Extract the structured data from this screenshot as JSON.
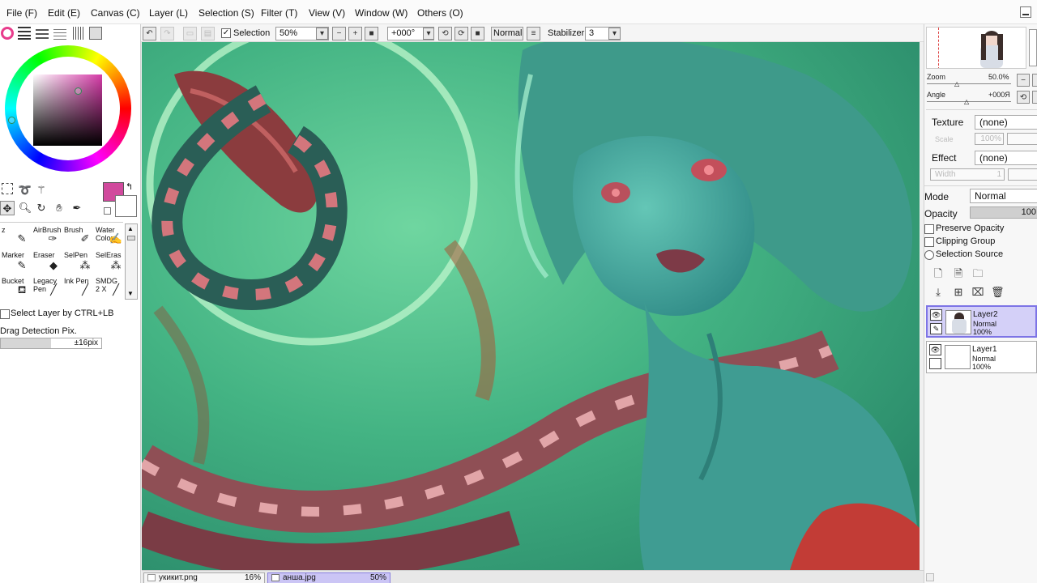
{
  "menu": [
    {
      "label": "File (F)"
    },
    {
      "label": "Edit (E)"
    },
    {
      "label": "Canvas (C)"
    },
    {
      "label": "Layer (L)"
    },
    {
      "label": "Selection (S)"
    },
    {
      "label": "Filter (T)"
    },
    {
      "label": "View (V)"
    },
    {
      "label": "Window (W)"
    },
    {
      "label": "Others (O)"
    }
  ],
  "toolbar": {
    "selection_label": "Selection",
    "selection_checked": "✓",
    "zoom_value": "50%",
    "angle_value": "+000°",
    "blend_mode": "Normal",
    "stabilizer_label": "Stabilizer",
    "stabilizer_value": "3"
  },
  "colors": {
    "primary": "#d14a9d",
    "secondary": "#ffffff",
    "layer_selected": "#d4d0f8"
  },
  "brushes": [
    {
      "label": "z",
      "icon": "pen-icon"
    },
    {
      "label": "AirBrush",
      "icon": "airbrush-icon"
    },
    {
      "label": "Brush",
      "icon": "brush-icon"
    },
    {
      "label": "Water Color",
      "icon": "watercolor-icon"
    },
    {
      "label": "Marker",
      "icon": "marker-icon"
    },
    {
      "label": "Eraser",
      "icon": "eraser-icon"
    },
    {
      "label": "SelPen",
      "icon": "selpen-icon"
    },
    {
      "label": "SelEras",
      "icon": "seleras-icon"
    },
    {
      "label": "Bucket",
      "icon": "bucket-icon"
    },
    {
      "label": "Legacy Pen",
      "icon": "legacy-pen-icon"
    },
    {
      "label": "Ink Pen",
      "icon": "ink-pen-icon"
    },
    {
      "label": "SMDG 2 X",
      "icon": "smdg-icon"
    }
  ],
  "left_options": {
    "select_layer_label": "Select Layer by CTRL+LB",
    "drag_detection_label": "Drag Detection Pix.",
    "drag_detection_value": "±16pix"
  },
  "navigator": {
    "zoom_label": "Zoom",
    "zoom_value": "50.0%",
    "angle_label": "Angle",
    "angle_value": "+000Я"
  },
  "properties": {
    "texture_label": "Texture",
    "texture_value": "(none)",
    "scale_label": "Scale",
    "scale_value": "100%",
    "effect_label": "Effect",
    "effect_value": "(none)",
    "width_label": "Width",
    "width_value": "1",
    "mode_label": "Mode",
    "mode_value": "Normal",
    "opacity_label": "Opacity",
    "opacity_value": "100",
    "preserve_opacity": "Preserve Opacity",
    "clipping_group": "Clipping Group",
    "selection_source": "Selection Source"
  },
  "layers": [
    {
      "name": "Layer2",
      "mode": "Normal",
      "opacity": "100%",
      "selected": true
    },
    {
      "name": "Layer1",
      "mode": "Normal",
      "opacity": "100%",
      "selected": false
    }
  ],
  "file_tabs": [
    {
      "name": "укикит.png",
      "zoom": "16%"
    },
    {
      "name": "анша.jpg",
      "zoom": "50%"
    }
  ]
}
